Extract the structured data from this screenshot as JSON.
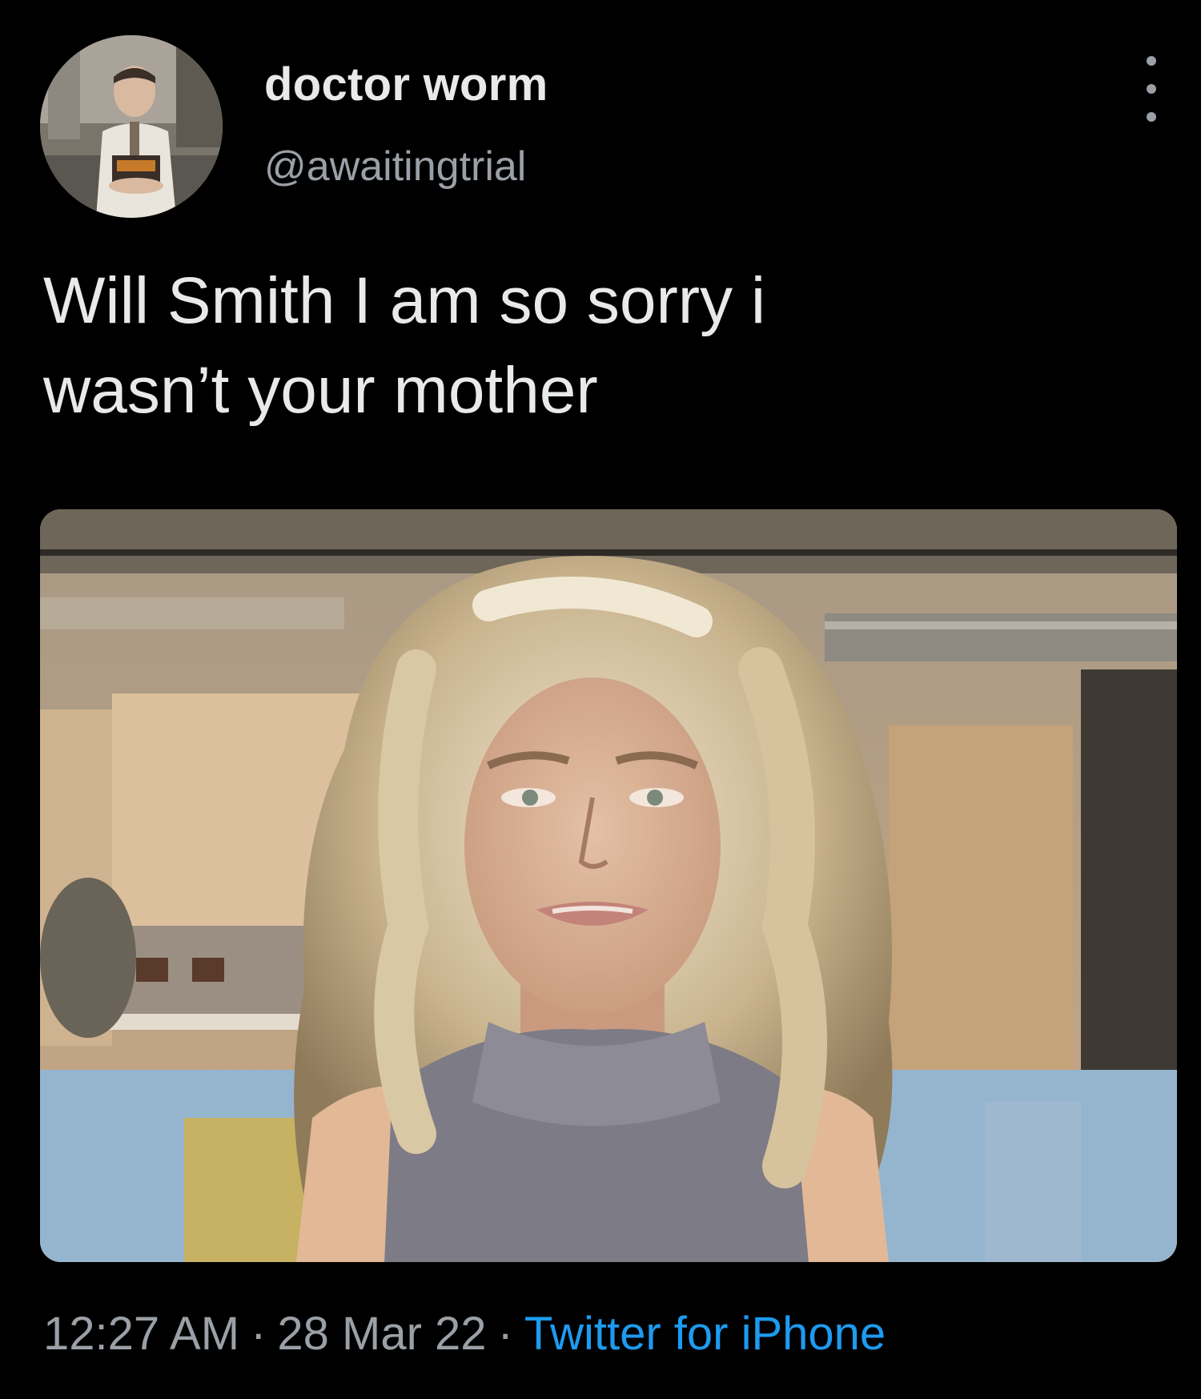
{
  "author": {
    "display_name": "doctor worm",
    "handle": "@awaitingtrial",
    "avatar_icon": "profile-photo"
  },
  "tweet": {
    "text_lines": [
      "Will Smith I am so sorry i",
      "wasn’t your mother"
    ]
  },
  "footer": {
    "time": "12:27 AM",
    "separator": "·",
    "date": "28 Mar 22",
    "source": "Twitter for iPhone"
  },
  "colors": {
    "background": "#000000",
    "primary_text": "#e7e9ea",
    "secondary_text": "#9aa0a6",
    "link": "#1d9bf0"
  },
  "icons": {
    "more": "more-dots-icon"
  }
}
